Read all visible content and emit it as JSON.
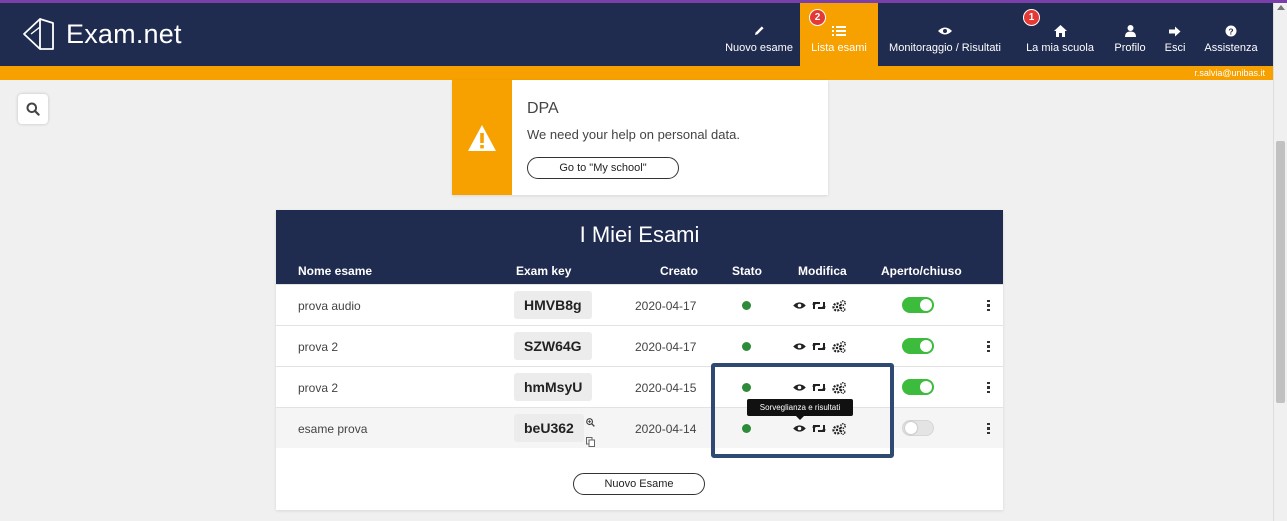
{
  "app": {
    "logo_text": "Exam.net",
    "user_email": "r.salvia@unibas.it"
  },
  "nav": {
    "new_exam": "Nuovo esame",
    "exam_list": "Lista esami",
    "exam_list_badge": "2",
    "monitoring": "Monitoraggio / Risultati",
    "my_school": "La mia scuola",
    "my_school_badge": "1",
    "profile": "Profilo",
    "logout": "Esci",
    "help": "Assistenza"
  },
  "dpa": {
    "title": "DPA",
    "text": "We need your help on personal data.",
    "button": "Go to \"My school\""
  },
  "exams": {
    "title": "I Miei Esami",
    "columns": {
      "name": "Nome esame",
      "key": "Exam key",
      "created": "Creato",
      "status": "Stato",
      "edit": "Modifica",
      "open": "Aperto/chiuso"
    },
    "rows": [
      {
        "name": "prova audio",
        "key": "HMVB8g",
        "created": "2020-04-17",
        "open": true
      },
      {
        "name": "prova 2",
        "key": "SZW64G",
        "created": "2020-04-17",
        "open": true
      },
      {
        "name": "prova 2",
        "key": "hmMsyU",
        "created": "2020-04-15",
        "open": true
      },
      {
        "name": "esame prova",
        "key": "beU362",
        "created": "2020-04-14",
        "open": false
      }
    ],
    "new_button": "Nuovo Esame"
  },
  "tooltip": "Sorveglianza e risultati",
  "colors": {
    "navy": "#1f2b4f",
    "orange": "#f7a100",
    "green": "#3dbb3d",
    "highlight_border": "#2e4a73"
  }
}
